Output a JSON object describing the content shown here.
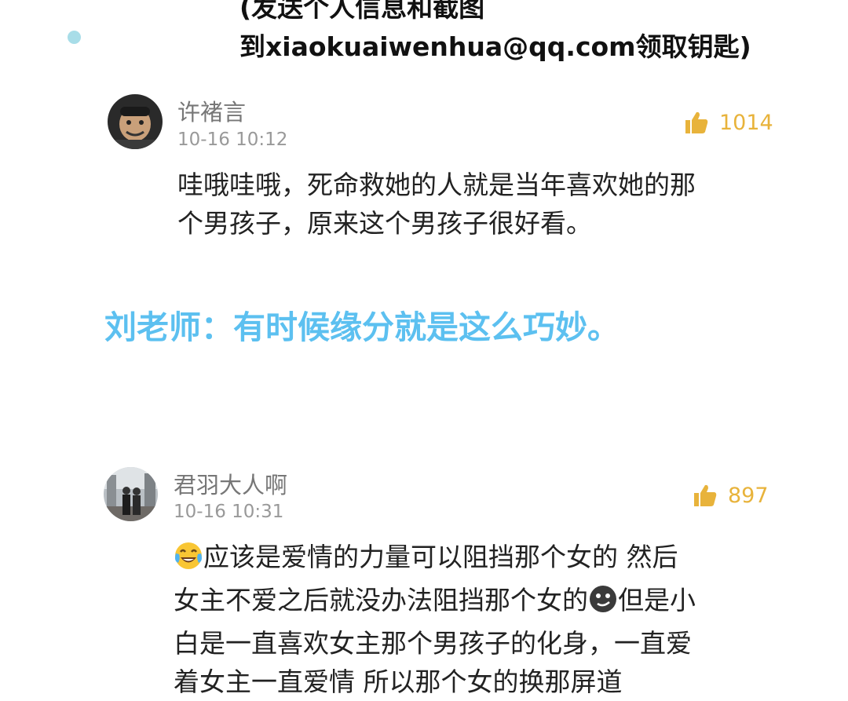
{
  "banner": {
    "line1": "(发送个人信息和截图",
    "line2": "到xiaokuaiwenhua@qq.com领取钥匙)"
  },
  "comments": [
    {
      "username": "许褚言",
      "time": "10-16 10:12",
      "likes": "1014",
      "lines": [
        "哇哦哇哦，死命救她的人就是当年喜欢她的那",
        "个男孩子，原来这个男孩子很好看。"
      ]
    },
    {
      "username": "君羽大人啊",
      "time": "10-16 10:31",
      "likes": "897",
      "line1": "应该是爱情的力量可以阻挡那个女的 然后",
      "line2a": "女主不爱之后就没办法阻挡那个女的",
      "line2b": "但是小",
      "line3": "白是一直喜欢女主那个男孩子的化身，一直爱",
      "line4": "着女主一直爱情 所以那个女的换那屏道",
      "emojis": [
        "laughing-tears-emoji",
        "smirk-emoji"
      ]
    }
  ],
  "teacher_note": "刘老师：有时候缘分就是这么巧妙。",
  "colors": {
    "accent_blue": "#5cc0f0",
    "like_gold": "#e8b33b",
    "dot": "#a8dde8"
  }
}
